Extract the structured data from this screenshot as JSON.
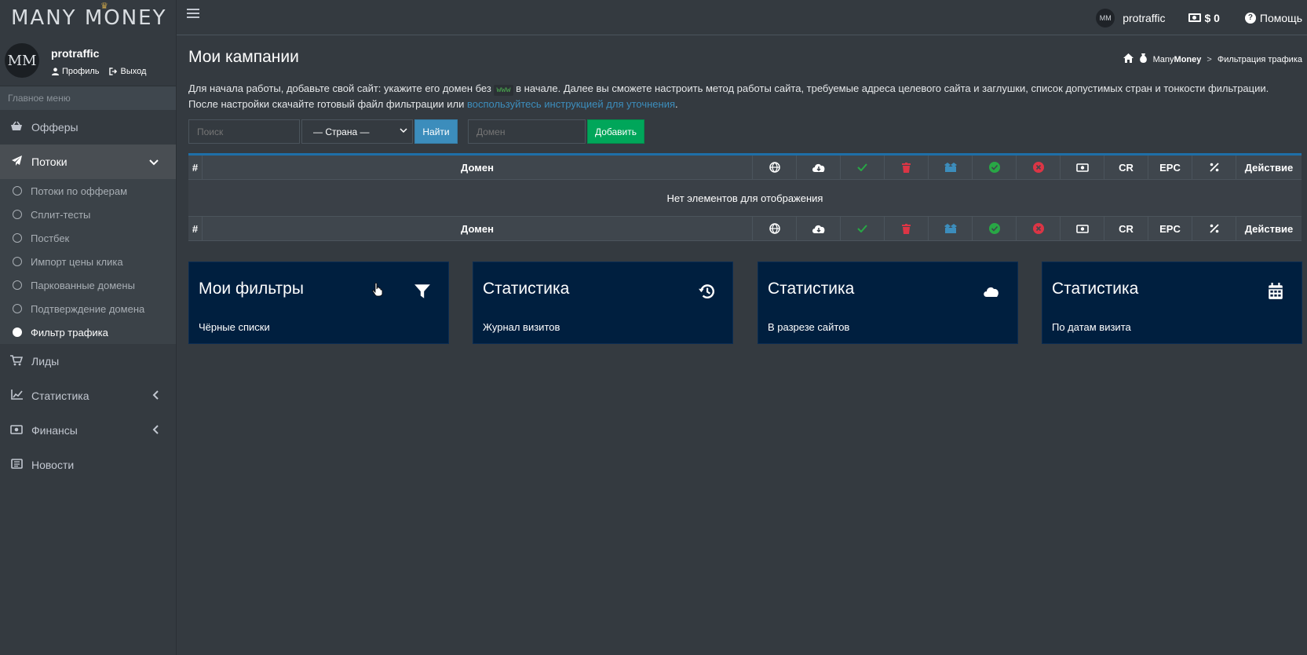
{
  "brand": {
    "name": "MANY MONEY",
    "crown": "♛"
  },
  "navbar": {
    "user_initials": "MM",
    "user_name": "protraffic",
    "balance": "$ 0",
    "help": "Помощь"
  },
  "sidebar": {
    "avatar_initials": "MM",
    "user_name": "protraffic",
    "profile_link": "Профиль",
    "logout_link": "Выход",
    "menu_header": "Главное меню",
    "items": [
      {
        "label": "Офферы",
        "icon": "basket-icon"
      },
      {
        "label": "Потоки",
        "icon": "paper-plane-icon"
      },
      {
        "label": "Лиды",
        "icon": "cart-icon"
      },
      {
        "label": "Статистика",
        "icon": "chart-icon"
      },
      {
        "label": "Финансы",
        "icon": "money-icon"
      },
      {
        "label": "Новости",
        "icon": "newspaper-icon"
      }
    ],
    "submenu": [
      "Потоки по офферам",
      "Сплит-тесты",
      "Постбек",
      "Импорт цены клика",
      "Паркованные домены",
      "Подтверждение домена",
      "Фильтр трафика"
    ]
  },
  "page": {
    "title": "Мои кампании",
    "breadcrumb": {
      "brand_regular": "Many",
      "brand_bold": "Money",
      "separator": ">",
      "current": "Фильтрация трафика"
    },
    "intro_part1": "Для начала работы, добавьте свой сайт: укажите его домен без",
    "intro_code": "www",
    "intro_part2": "в начале. Далее вы сможете настроить метод работы сайта, требуемые адреса целевого сайта и заглушки, список допустимых стран и тонкости фильтрации.",
    "intro_part3": "После настройки скачайте готовый файл фильтрации или",
    "intro_link": "воспользуйтесь инструкцией для уточнения",
    "intro_end": "."
  },
  "filters": {
    "search_placeholder": "Поиск",
    "country_selected": "— Страна —",
    "find_button": "Найти",
    "domain_placeholder": "Домен",
    "add_button": "Добавить"
  },
  "table": {
    "columns": [
      "#",
      "Домен",
      "globe-icon",
      "cloud-download-icon",
      "check-icon",
      "trash-icon",
      "boxes-icon",
      "check-circle-icon",
      "times-circle-icon",
      "money-bill-icon",
      "CR",
      "EPC",
      "percent-icon",
      "Действие"
    ],
    "header_hash": "#",
    "header_domain": "Домен",
    "header_cr": "CR",
    "header_epc": "EPC",
    "header_action": "Действие",
    "empty_message": "Нет элементов для отображения"
  },
  "cards": [
    {
      "title": "Мои фильтры",
      "subtitle": "Чёрные списки",
      "icon": "filter-icon"
    },
    {
      "title": "Статистика",
      "subtitle": "Журнал визитов",
      "icon": "history-icon"
    },
    {
      "title": "Статистика",
      "subtitle": "В разрезе сайтов",
      "icon": "cloud-icon"
    },
    {
      "title": "Статистика",
      "subtitle": "По датам визита",
      "icon": "calendar-icon"
    }
  ],
  "colors": {
    "accent_blue": "#3c8dbc",
    "success_green": "#00a65a",
    "danger_red": "#dc3545",
    "card_navy": "#001f3f"
  }
}
